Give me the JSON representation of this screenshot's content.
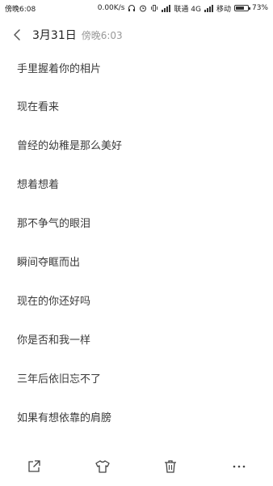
{
  "status_bar": {
    "left_text": "傍晚6:08",
    "speed": "0.00K/s",
    "carrier1": "联通 4G",
    "carrier2": "移动",
    "battery_percent": "73%",
    "battery_level": 0.73
  },
  "header": {
    "date": "3月31日",
    "time": "傍晚6:03"
  },
  "note": {
    "lines": [
      "手里握着你的相片",
      "现在看来",
      "曾经的幼稚是那么美好",
      "想着想着",
      "那不争气的眼泪",
      "瞬间夺眶而出",
      "现在的你还好吗",
      "你是否和我一样",
      "三年后依旧忘不了",
      "如果有想依靠的肩膀"
    ]
  },
  "toolbar": {
    "icons": [
      "share-icon",
      "shirt-icon",
      "trash-icon",
      "more-icon"
    ]
  }
}
